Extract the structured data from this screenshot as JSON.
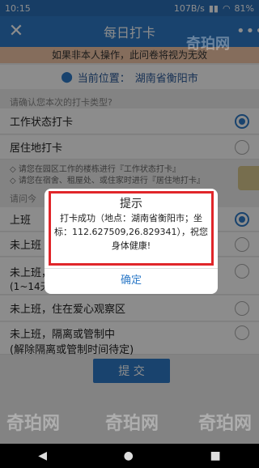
{
  "status": {
    "time": "10:15",
    "speed": "107B/s",
    "battery": "81%"
  },
  "header": {
    "title": "每日打卡"
  },
  "warning": "如果非本人操作，此问卷将视为无效",
  "location": {
    "label": "当前位置：",
    "value": "湖南省衡阳市"
  },
  "type_section": {
    "label": "请确认您本次的打卡类型?",
    "options": [
      {
        "label": "工作状态打卡",
        "selected": true
      },
      {
        "label": "居住地打卡",
        "selected": false
      }
    ],
    "hints": [
      "◇ 请您在园区工作的楼栋进行『工作状态打卡』",
      "◇ 请您在宿舍、租屋处、或住家时进行『居住地打卡』"
    ]
  },
  "status_section": {
    "label": "请问今",
    "options": [
      {
        "label": "上班",
        "selected": true
      },
      {
        "label": "未上班",
        "selected": false
      },
      {
        "label": "未上班，",
        "sub": "(1~14天",
        "selected": false
      },
      {
        "label": "未上班，住在爱心观察区",
        "selected": false
      },
      {
        "label": "未上班，隔离或管制中",
        "sub": "(解除隔离或管制时间待定)",
        "selected": false
      }
    ]
  },
  "submit_label": "提 交",
  "dialog": {
    "title": "提示",
    "message": "打卡成功（地点：湖南省衡阳市；坐标：112.627509,26.829341），祝您身体健康!",
    "ok": "确定"
  },
  "watermarks": [
    "奇珀网",
    "奇珀网",
    "奇珀网",
    "奇珀网"
  ],
  "colors": {
    "primary": "#2f7bc8",
    "warning_bg": "#f3c7a8",
    "highlight": "#e0262a"
  }
}
